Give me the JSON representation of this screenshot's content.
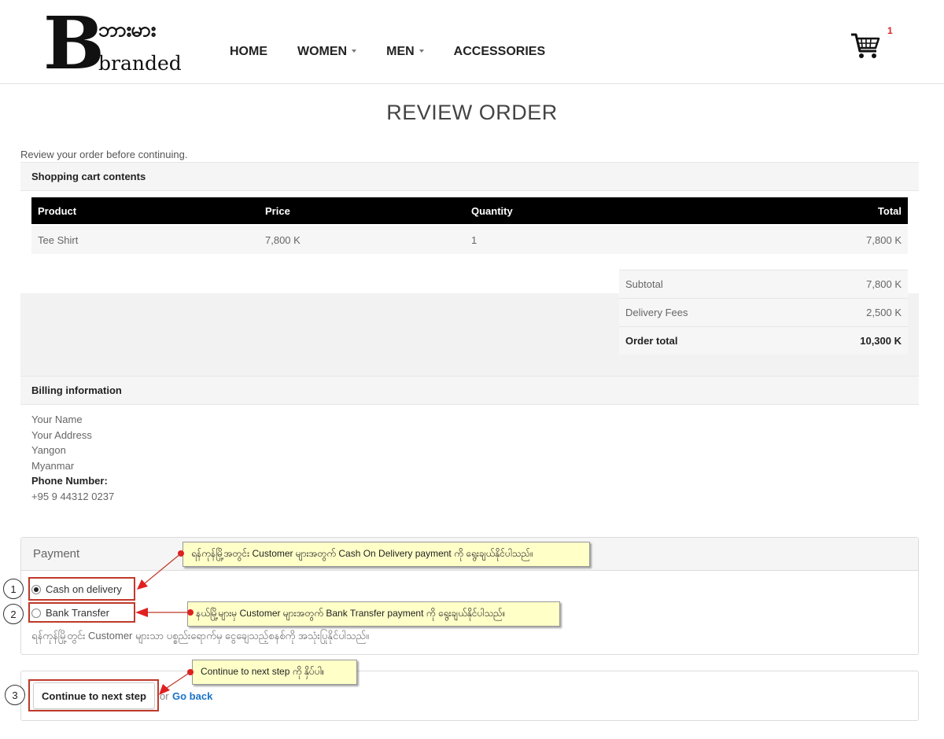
{
  "brand": {
    "script_text": "ဘားမား",
    "name": "branded",
    "letter": "B"
  },
  "nav": [
    {
      "label": "HOME",
      "dropdown": false
    },
    {
      "label": "WOMEN",
      "dropdown": true
    },
    {
      "label": "MEN",
      "dropdown": true
    },
    {
      "label": "ACCESSORIES",
      "dropdown": false
    }
  ],
  "cart": {
    "count": "1",
    "icon": "shopping-cart-icon"
  },
  "page": {
    "title": "REVIEW ORDER",
    "intro": "Review your order before continuing."
  },
  "cart_section": {
    "heading": "Shopping cart contents",
    "columns": {
      "product": "Product",
      "price": "Price",
      "quantity": "Quantity",
      "total": "Total"
    },
    "items": [
      {
        "product": "Tee Shirt",
        "price": "7,800 K",
        "quantity": "1",
        "total": "7,800 K"
      }
    ]
  },
  "totals": {
    "subtotal_label": "Subtotal",
    "subtotal": "7,800 K",
    "delivery_label": "Delivery Fees",
    "delivery": "2,500 K",
    "order_total_label": "Order total",
    "order_total": "10,300 K"
  },
  "billing": {
    "heading": "Billing information",
    "name": "Your Name",
    "address": "Your Address",
    "city": "Yangon",
    "country": "Myanmar",
    "phone_label": "Phone Number:",
    "phone": "+95 9 44312 0237"
  },
  "payment": {
    "heading": "Payment",
    "options": [
      {
        "label": "Cash on delivery",
        "selected": true
      },
      {
        "label": "Bank Transfer",
        "selected": false
      }
    ],
    "note": "ရန်ကုန်မြို့တွင်း Customer များသာ ပစ္စည်းရောက်မှ ငွေချေသည့်စနစ်ကို အသုံးပြုနိုင်ပါသည်။"
  },
  "actions": {
    "continue_label": "Continue to next step",
    "or_text": "or",
    "go_back_label": "Go back"
  },
  "annotations": {
    "colors": {
      "frame": "#c0392b",
      "callout_bg": "#ffffc8",
      "link": "#1a73c7"
    },
    "numbers": [
      "1",
      "2",
      "3"
    ],
    "callout_1": "ရန်ကုန်မြို့အတွင်း Customer များအတွက် Cash On Delivery payment ကို ရွေးချယ်နိုင်ပါသည်။",
    "callout_2": "နယ်မြို့များမှ Customer များအတွက် Bank Transfer payment ကို ရွေးချယ်နိုင်ပါသည်။",
    "callout_3": "Continue to next step ကို နှိပ်ပါ။"
  }
}
